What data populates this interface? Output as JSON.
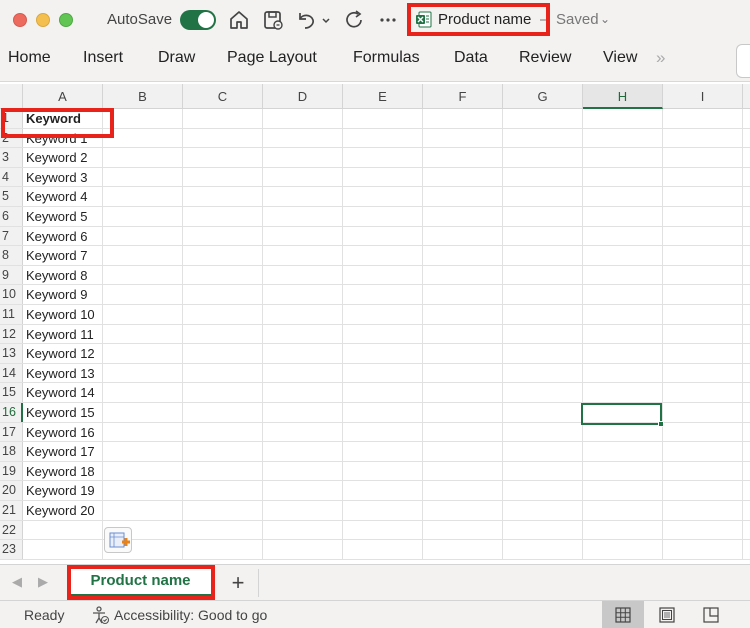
{
  "titlebar": {
    "autosave_label": "AutoSave",
    "autosave_on": true,
    "document_title": "Product name",
    "title_separator": "–",
    "save_status": "Saved"
  },
  "ribbon": {
    "tabs": [
      "Home",
      "Insert",
      "Draw",
      "Page Layout",
      "Formulas",
      "Data",
      "Review",
      "View"
    ],
    "more_label": "»"
  },
  "grid": {
    "columns": [
      "A",
      "B",
      "C",
      "D",
      "E",
      "F",
      "G",
      "H",
      "I"
    ],
    "selected_column": "H",
    "selected_row": "16",
    "rows": [
      {
        "num": "1",
        "a": "Keyword"
      },
      {
        "num": "2",
        "a": "Keyword 1"
      },
      {
        "num": "3",
        "a": "Keyword 2"
      },
      {
        "num": "4",
        "a": "Keyword 3"
      },
      {
        "num": "5",
        "a": "Keyword 4"
      },
      {
        "num": "6",
        "a": "Keyword 5"
      },
      {
        "num": "7",
        "a": "Keyword 6"
      },
      {
        "num": "8",
        "a": "Keyword 7"
      },
      {
        "num": "9",
        "a": "Keyword 8"
      },
      {
        "num": "10",
        "a": "Keyword 9"
      },
      {
        "num": "11",
        "a": "Keyword 10"
      },
      {
        "num": "12",
        "a": "Keyword 11"
      },
      {
        "num": "13",
        "a": "Keyword 12"
      },
      {
        "num": "14",
        "a": "Keyword 13"
      },
      {
        "num": "15",
        "a": "Keyword 14"
      },
      {
        "num": "16",
        "a": "Keyword 15"
      },
      {
        "num": "17",
        "a": "Keyword 16"
      },
      {
        "num": "18",
        "a": "Keyword 17"
      },
      {
        "num": "19",
        "a": "Keyword 18"
      },
      {
        "num": "20",
        "a": "Keyword 19"
      },
      {
        "num": "21",
        "a": "Keyword 20"
      },
      {
        "num": "22",
        "a": ""
      },
      {
        "num": "23",
        "a": ""
      }
    ]
  },
  "sheets": {
    "tabs": [
      "Product name"
    ],
    "add_label": "+"
  },
  "status": {
    "ready": "Ready",
    "accessibility": "Accessibility: Good to go"
  },
  "colors": {
    "accent": "#217346",
    "highlight_box": "#e8231b"
  }
}
